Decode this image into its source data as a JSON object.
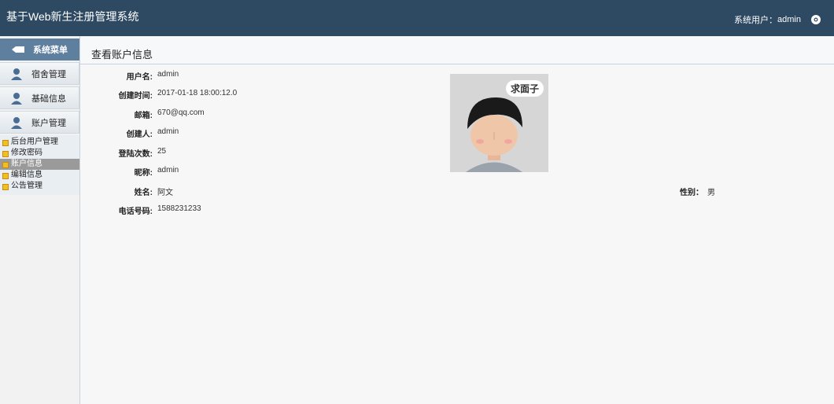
{
  "app": {
    "title": "基于Web新生注册管理系统",
    "user_label": "系统用户：",
    "user_name": "admin"
  },
  "sidebar": {
    "header": "系统菜单",
    "items": [
      {
        "label": "宿舍管理"
      },
      {
        "label": "基础信息"
      },
      {
        "label": "账户管理"
      }
    ],
    "submenu": [
      {
        "label": "后台用户管理"
      },
      {
        "label": "修改密码"
      },
      {
        "label": "账户信息",
        "active": true
      },
      {
        "label": "编辑信息"
      },
      {
        "label": "公告管理"
      }
    ]
  },
  "page": {
    "title": "查看账户信息"
  },
  "account": {
    "username": {
      "label": "用户名:",
      "value": "admin"
    },
    "created_time": {
      "label": "创建时间:",
      "value": "2017-01-18 18:00:12.0"
    },
    "email": {
      "label": "邮箱:",
      "value": "670@qq.com"
    },
    "creator": {
      "label": "创建人:",
      "value": "admin"
    },
    "login_count": {
      "label": "登陆次数:",
      "value": "25"
    },
    "nickname": {
      "label": "昵称:",
      "value": "admin"
    },
    "real_name": {
      "label": "姓名:",
      "value": "阿文"
    },
    "gender": {
      "label": "性别：",
      "value": "男"
    },
    "phone": {
      "label": "电话号码:",
      "value": "1588231233"
    }
  },
  "avatar": {
    "bubble_text": "求面子"
  },
  "colors": {
    "topbar": "#2e4a63",
    "menu_header": "#5f7f9f",
    "active_sub": "#9a9a9a"
  }
}
